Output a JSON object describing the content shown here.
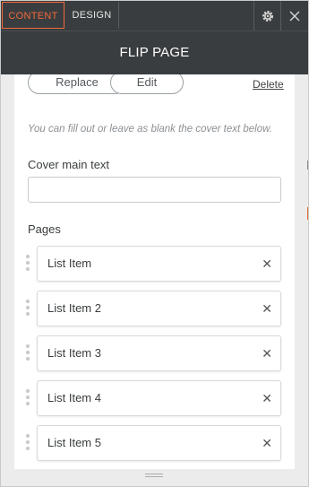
{
  "tabs": {
    "content_label": "CONTENT",
    "design_label": "DESIGN"
  },
  "header": {
    "title": "FLIP PAGE"
  },
  "actions": {
    "replace_label": "Replace",
    "edit_label": "Edit",
    "delete_label": "Delete"
  },
  "form": {
    "hint": "You can fill out or leave as blank the cover text below.",
    "cover_label": "Cover main text",
    "cover_value": "",
    "cover_placeholder": "",
    "pages_label": "Pages"
  },
  "pages": [
    {
      "label": "List Item"
    },
    {
      "label": "List Item 2"
    },
    {
      "label": "List Item 3"
    },
    {
      "label": "List Item 4"
    },
    {
      "label": "List Item 5"
    }
  ],
  "icons": {
    "settings": "gear-icon",
    "close": "close-icon",
    "remove": "remove-icon",
    "drag": "drag-handle-icon"
  },
  "colors": {
    "accent": "#f06a3c",
    "header_bg": "#3a3d3f"
  }
}
